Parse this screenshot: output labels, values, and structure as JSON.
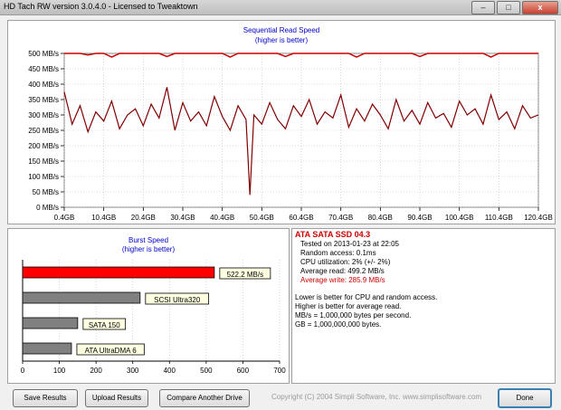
{
  "window": {
    "title": "HD Tach RW version 3.0.4.0 - Licensed to Tweaktown"
  },
  "window_buttons": {
    "minimize": "–",
    "maximize": "□",
    "close": "x"
  },
  "read_panel": {
    "title": "Sequential Read Speed",
    "subtitle": "(higher is better)",
    "y_ticks": [
      "500 MB/s",
      "450 MB/s",
      "400 MB/s",
      "350 MB/s",
      "300 MB/s",
      "250 MB/s",
      "200 MB/s",
      "150 MB/s",
      "100 MB/s",
      "50 MB/s",
      "0 MB/s"
    ],
    "x_ticks": [
      "0.4GB",
      "10.4GB",
      "20.4GB",
      "30.4GB",
      "40.4GB",
      "50.4GB",
      "60.4GB",
      "70.4GB",
      "80.4GB",
      "90.4GB",
      "100.4GB",
      "110.4GB",
      "120.4GB"
    ]
  },
  "burst_panel": {
    "title": "Burst Speed",
    "subtitle": "(higher is better)",
    "x_ticks": [
      "0",
      "100",
      "200",
      "300",
      "400",
      "500",
      "600",
      "700"
    ]
  },
  "chart_data": [
    {
      "type": "line",
      "title": "Sequential Read Speed",
      "subtitle": "(higher is better)",
      "ylim": [
        0,
        500
      ],
      "xlim": [
        0.4,
        120.4
      ],
      "series": [
        {
          "name": "Average read",
          "color": "#800000",
          "x": [
            0.4,
            2.4,
            4.4,
            6.4,
            8.4,
            10.4,
            12.4,
            14.4,
            16.4,
            18.4,
            20.4,
            22.4,
            24.4,
            26.4,
            28.4,
            30.4,
            32.4,
            34.4,
            36.4,
            38.4,
            40.4,
            42.4,
            44.4,
            46.4,
            47.4,
            48.4,
            50.4,
            52.4,
            54.4,
            56.4,
            58.4,
            60.4,
            62.4,
            64.4,
            66.4,
            68.4,
            70.4,
            72.4,
            74.4,
            76.4,
            78.4,
            80.4,
            82.4,
            84.4,
            86.4,
            88.4,
            90.4,
            92.4,
            94.4,
            96.4,
            98.4,
            100.4,
            102.4,
            104.4,
            106.4,
            108.4,
            110.4,
            112.4,
            114.4,
            116.4,
            118.4,
            120.4
          ],
          "y": [
            375,
            270,
            330,
            245,
            310,
            280,
            345,
            255,
            300,
            320,
            265,
            335,
            290,
            390,
            250,
            340,
            280,
            310,
            265,
            360,
            295,
            250,
            330,
            285,
            40,
            300,
            270,
            340,
            285,
            255,
            330,
            295,
            350,
            270,
            310,
            290,
            365,
            260,
            320,
            280,
            335,
            300,
            255,
            350,
            280,
            315,
            270,
            340,
            290,
            305,
            260,
            345,
            300,
            320,
            270,
            365,
            285,
            310,
            255,
            330,
            290,
            300
          ]
        },
        {
          "name": "Average write",
          "color": "#cc0000",
          "x": [
            0.4,
            2.4,
            4.4,
            6.4,
            8.4,
            10.4,
            12.4,
            14.4,
            16.4,
            18.4,
            20.4,
            22.4,
            24.4,
            26.4,
            28.4,
            30.4,
            32.4,
            34.4,
            36.4,
            38.4,
            40.4,
            42.4,
            44.4,
            46.4,
            48.4,
            50.4,
            52.4,
            54.4,
            56.4,
            58.4,
            60.4,
            62.4,
            64.4,
            66.4,
            68.4,
            70.4,
            72.4,
            74.4,
            76.4,
            78.4,
            80.4,
            82.4,
            84.4,
            86.4,
            88.4,
            90.4,
            92.4,
            94.4,
            96.4,
            98.4,
            100.4,
            102.4,
            104.4,
            106.4,
            108.4,
            110.4,
            112.4,
            114.4,
            116.4,
            118.4,
            120.4
          ],
          "y": [
            500,
            500,
            500,
            495,
            500,
            500,
            488,
            500,
            500,
            500,
            500,
            500,
            500,
            490,
            500,
            500,
            500,
            500,
            500,
            500,
            500,
            488,
            500,
            500,
            500,
            500,
            500,
            500,
            490,
            500,
            500,
            500,
            500,
            500,
            500,
            500,
            500,
            488,
            500,
            500,
            500,
            500,
            500,
            500,
            500,
            490,
            500,
            500,
            500,
            500,
            500,
            500,
            500,
            500,
            488,
            500,
            500,
            500,
            500,
            500,
            500
          ]
        }
      ]
    },
    {
      "type": "bar",
      "title": "Burst Speed",
      "subtitle": "(higher is better)",
      "xlim": [
        0,
        700
      ],
      "categories": [
        "ATA SATA SSD 04.3",
        "SCSI Ultra320",
        "SATA 150",
        "ATA UltraDMA 6"
      ],
      "values": [
        522.2,
        320,
        150,
        133
      ],
      "labels": [
        "522.2 MB/s",
        "SCSI Ultra320",
        "SATA 150",
        "ATA UltraDMA 6"
      ],
      "colors": [
        "#ff0000",
        "#808080",
        "#808080",
        "#808080"
      ]
    }
  ],
  "info": {
    "drive_name": "ATA SATA SSD 04.3",
    "tested": "Tested on 2013-01-23 at 22:05",
    "random_access": "Random access: 0.1ms",
    "cpu": "CPU utilization: 2% (+/- 2%)",
    "avg_read": "Average read: 499.2 MB/s",
    "avg_write": "Average write: 285.9 MB/s",
    "note1": "Lower is better for CPU and random access.",
    "note2": "Higher is better for average read.",
    "note3": "MB/s = 1,000,000 bytes per second.",
    "note4": "GB = 1,000,000,000 bytes.",
    "accent_color": "#cc0000"
  },
  "buttons": {
    "save": "Save Results",
    "upload": "Upload Results",
    "compare": "Compare Another Drive",
    "done": "Done"
  },
  "copyright": "Copyright (C) 2004 Simpli Software, Inc. www.simplisoftware.com"
}
